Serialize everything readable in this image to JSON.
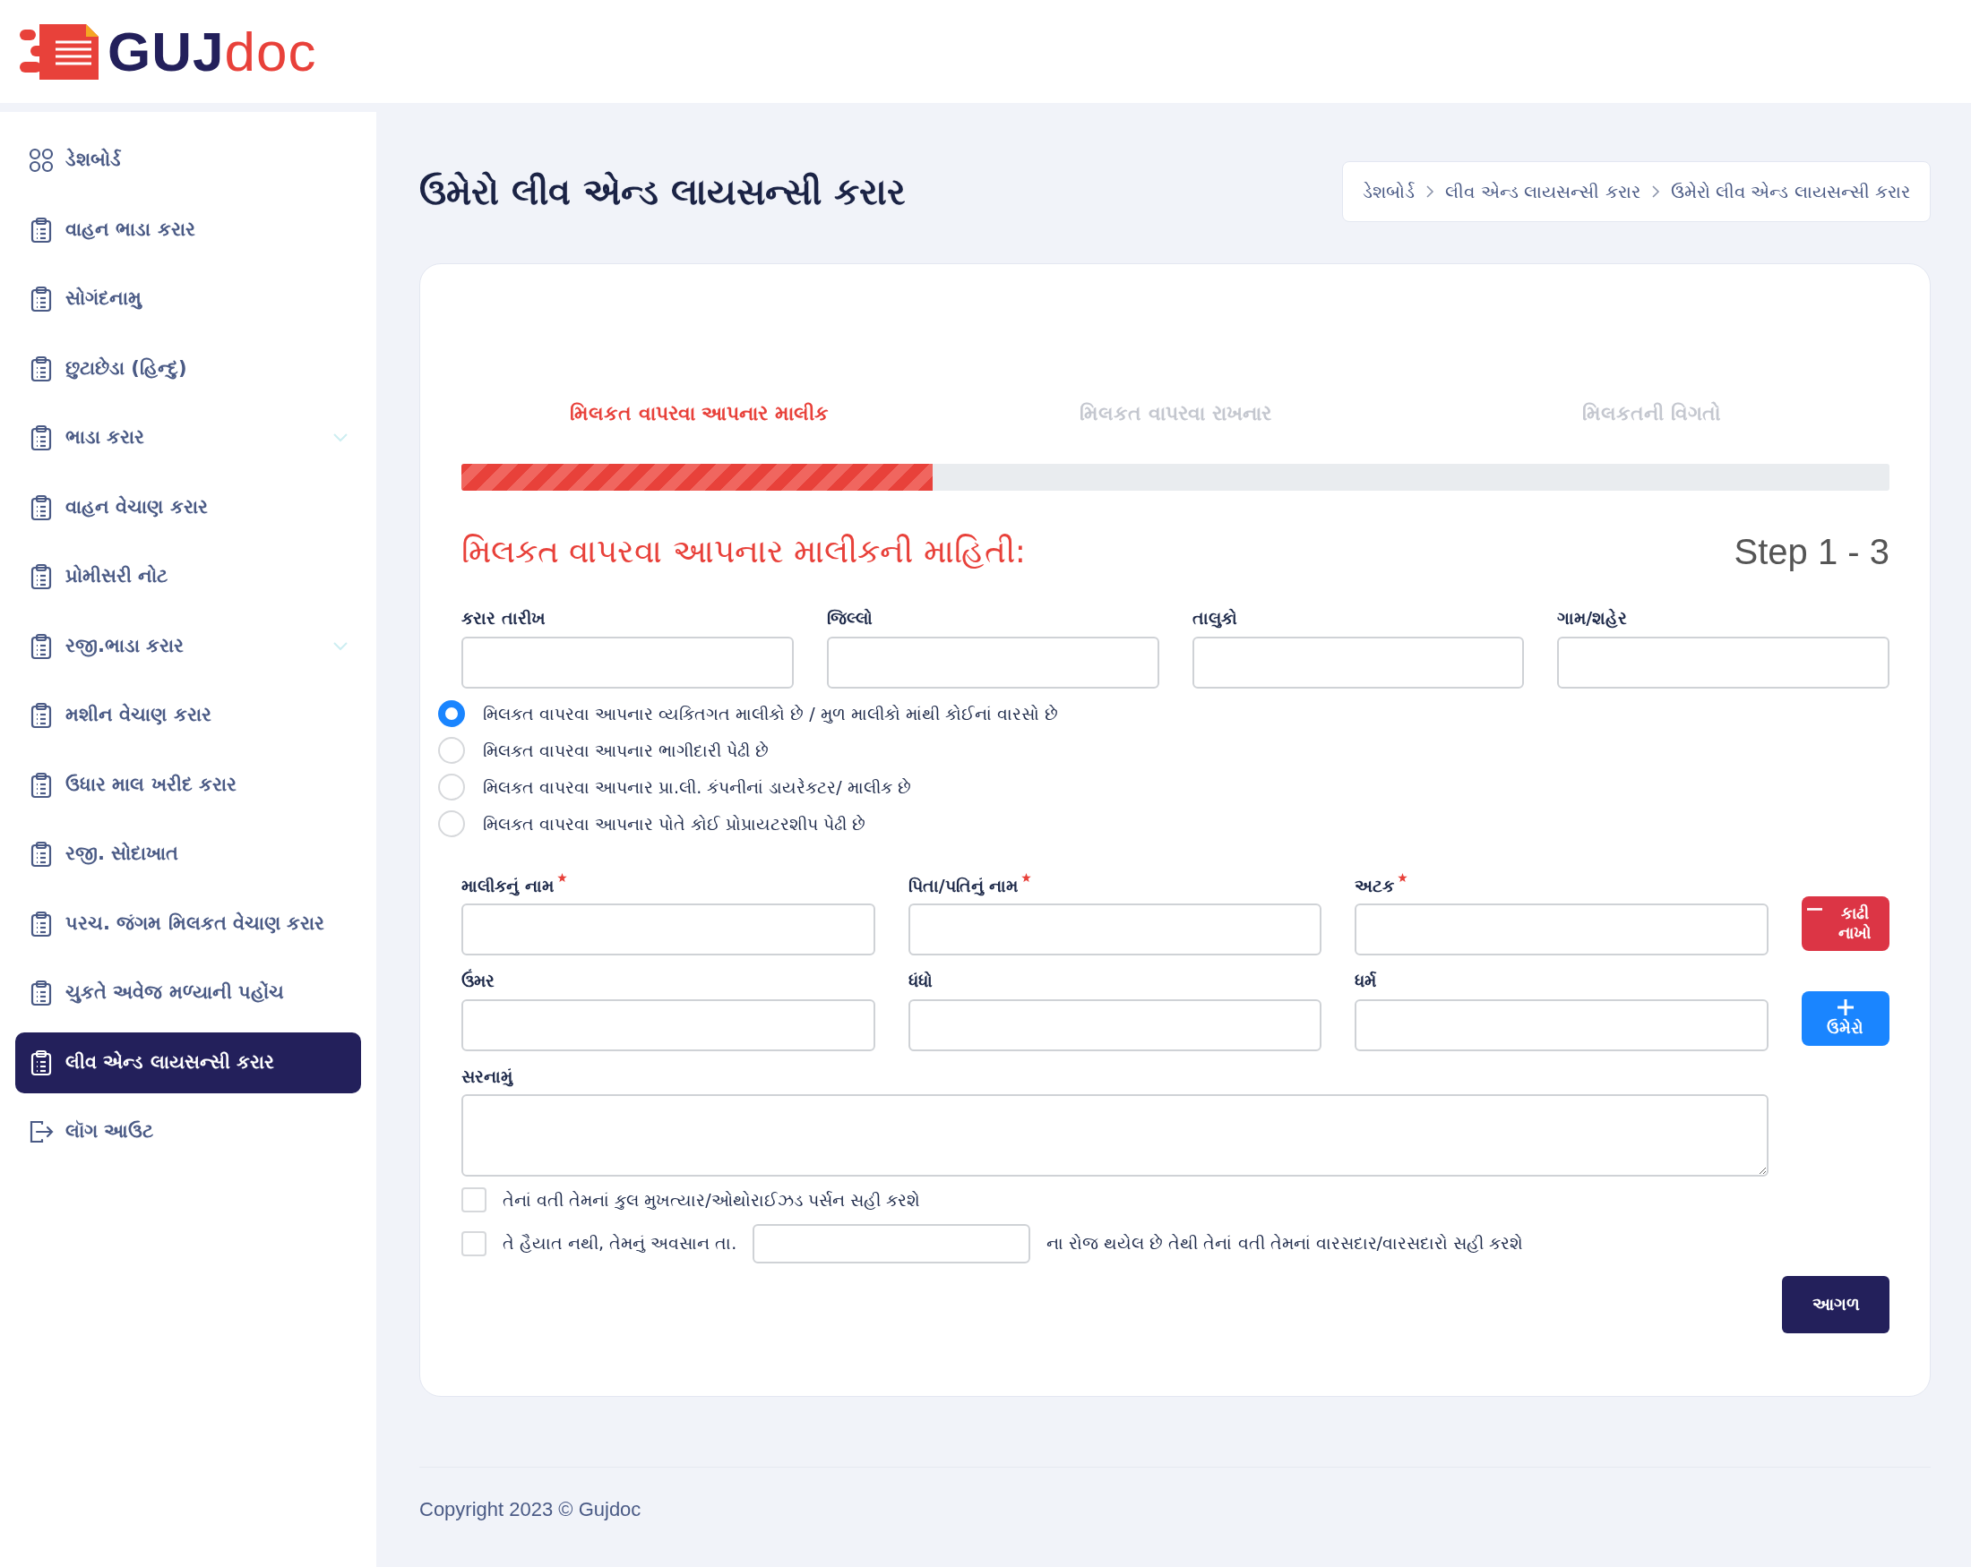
{
  "logo": {
    "brand": "GUJ",
    "brand_accent": "doc"
  },
  "sidebar": {
    "items": [
      {
        "label": "ડેશબોર્ડ",
        "kind": "dashboard",
        "selected": false,
        "expandable": false
      },
      {
        "label": "વાહન ભાડા કરાર",
        "kind": "clipboard",
        "selected": false,
        "expandable": false
      },
      {
        "label": "સોગંદનામુ",
        "kind": "clipboard",
        "selected": false,
        "expandable": false
      },
      {
        "label": "છુટાછેડા (હિન્દુ)",
        "kind": "clipboard",
        "selected": false,
        "expandable": false
      },
      {
        "label": "ભાડા કરાર",
        "kind": "clipboard",
        "selected": false,
        "expandable": true
      },
      {
        "label": "વાહન વેચાણ કરાર",
        "kind": "clipboard",
        "selected": false,
        "expandable": false
      },
      {
        "label": "પ્રોમીસરી નોટ",
        "kind": "clipboard",
        "selected": false,
        "expandable": false
      },
      {
        "label": "રજી.ભાડા કરાર",
        "kind": "clipboard",
        "selected": false,
        "expandable": true
      },
      {
        "label": "મશીન વેચાણ કરાર",
        "kind": "clipboard",
        "selected": false,
        "expandable": false
      },
      {
        "label": "ઉધાર માલ ખરીદ કરાર",
        "kind": "clipboard",
        "selected": false,
        "expandable": false
      },
      {
        "label": "રજી. સોદાખાત",
        "kind": "clipboard",
        "selected": false,
        "expandable": false
      },
      {
        "label": "પરચ. જંગમ મિલકત વેચાણ કરાર",
        "kind": "clipboard",
        "selected": false,
        "expandable": false
      },
      {
        "label": "ચુકતે અવેજ મળ્યાની પહોંચ",
        "kind": "clipboard",
        "selected": false,
        "expandable": false
      },
      {
        "label": "લીવ એન્ડ લાયસન્સી કરાર",
        "kind": "clipboard",
        "selected": true,
        "expandable": false
      },
      {
        "label": "લૉગ આઉટ",
        "kind": "logout",
        "selected": false,
        "expandable": false
      }
    ]
  },
  "page_title": "ઉમેરો લીવ એન્ડ લાયસન્સી કરાર",
  "breadcrumb": [
    "ડેશબોર્ડ",
    "લીવ એન્ડ લાયસન્સી કરાર",
    "ઉમેરો લીવ એન્ડ લાયસન્સી કરાર"
  ],
  "form": {
    "steps": [
      {
        "label": "મિલકત વાપરવા આપનાર માલીક",
        "selected": true
      },
      {
        "label": "મિલકત વાપરવા રાખનાર",
        "selected": false
      },
      {
        "label": "મિલકતની વિગતો",
        "selected": false
      }
    ],
    "progress": {
      "level": 0.33
    },
    "heading": "મિલકત વાપરવા આપનાર માલીકની માહિતી:",
    "step_counter": "Step 1 - 3",
    "top_fields": [
      {
        "label": "કરાર તારીખ"
      },
      {
        "label": "જિલ્લો"
      },
      {
        "label": "તાલુકો"
      },
      {
        "label": "ગામ/શહેર"
      }
    ],
    "radio_options": [
      {
        "label": "મિલકત વાપરવા આપનાર વ્યકિતગત માલીકો છે / મુળ માલીકો માંથી કોઈનાં વારસો છે",
        "selected": true
      },
      {
        "label": "મિલકત વાપરવા આપનાર ભાગીદારી પેઢી છે",
        "selected": false
      },
      {
        "label": "મિલકત વાપરવા આપનાર પ્રા.લી. કંપનીનાં ડાયરેકટર/ માલીક છે",
        "selected": false
      },
      {
        "label": "મિલકત વાપરવા આપનાર પોતે કોઈ પ્રોપ્રાયટરશીપ પેઢી છે",
        "selected": false
      }
    ],
    "fields": [
      {
        "label": "માલીકનું નામ",
        "required": true
      },
      {
        "label": "પિતા/પતિનું નામ",
        "required": true
      },
      {
        "label": "અટક",
        "required": true
      },
      {
        "label": "ઉંમર",
        "required": false
      },
      {
        "label": "ધંધો",
        "required": false
      },
      {
        "label": "ધર્મ",
        "required": false
      }
    ],
    "actions": [
      {
        "kind": "remove",
        "label": "કાઢી નાખો"
      },
      {
        "kind": "add",
        "label": "ઉમેરો"
      }
    ],
    "address_field": {
      "label": "સરનામું"
    },
    "checkboxes": [
      {
        "label": "તેનાં વતી તેમનાં કુલ મુખત્યાર/ઓથોરાઈઝડ પર્સન સહી કરશે",
        "checked": false
      },
      {
        "label": "તે હૈયાત નથી, તેમનું અવસાન તા.",
        "label_after": "ના રોજ થયેલ છે તેથી તેનાં વતી તેમનાં વારસદાર/વારસદારો સહી કરશે",
        "checked": false
      }
    ],
    "next_button": "આગળ"
  },
  "copyright": "Copyright 2023 © Gujdoc"
}
